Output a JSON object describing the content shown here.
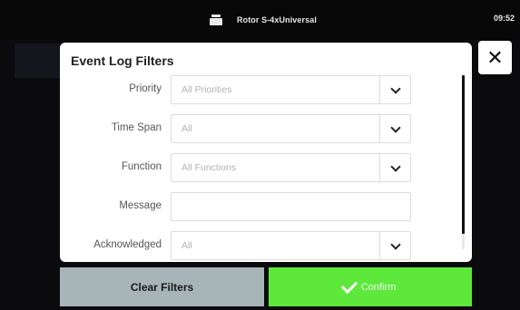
{
  "status_bar": {
    "device_icon": "device-icon",
    "device_name": "Rotor S-4xUniversal",
    "time": "09:52"
  },
  "dialog": {
    "title": "Event Log Filters",
    "close_icon": "close-icon",
    "close_label": "✕",
    "fields": [
      {
        "label": "Priority",
        "value": "All Priorities",
        "type": "select"
      },
      {
        "label": "Time Span",
        "value": "All",
        "type": "select"
      },
      {
        "label": "Function",
        "value": "All Functions",
        "type": "select"
      },
      {
        "label": "Message",
        "value": "",
        "type": "text"
      },
      {
        "label": "Acknowledged",
        "value": "All",
        "type": "select"
      }
    ]
  },
  "buttons": {
    "clear": "Clear Filters",
    "confirm": "Confirm",
    "confirm_icon": "check-icon"
  },
  "colors": {
    "confirm_green": "#5ee83b",
    "clear_gray": "#a7b5b8",
    "background": "#0b0b0d"
  }
}
